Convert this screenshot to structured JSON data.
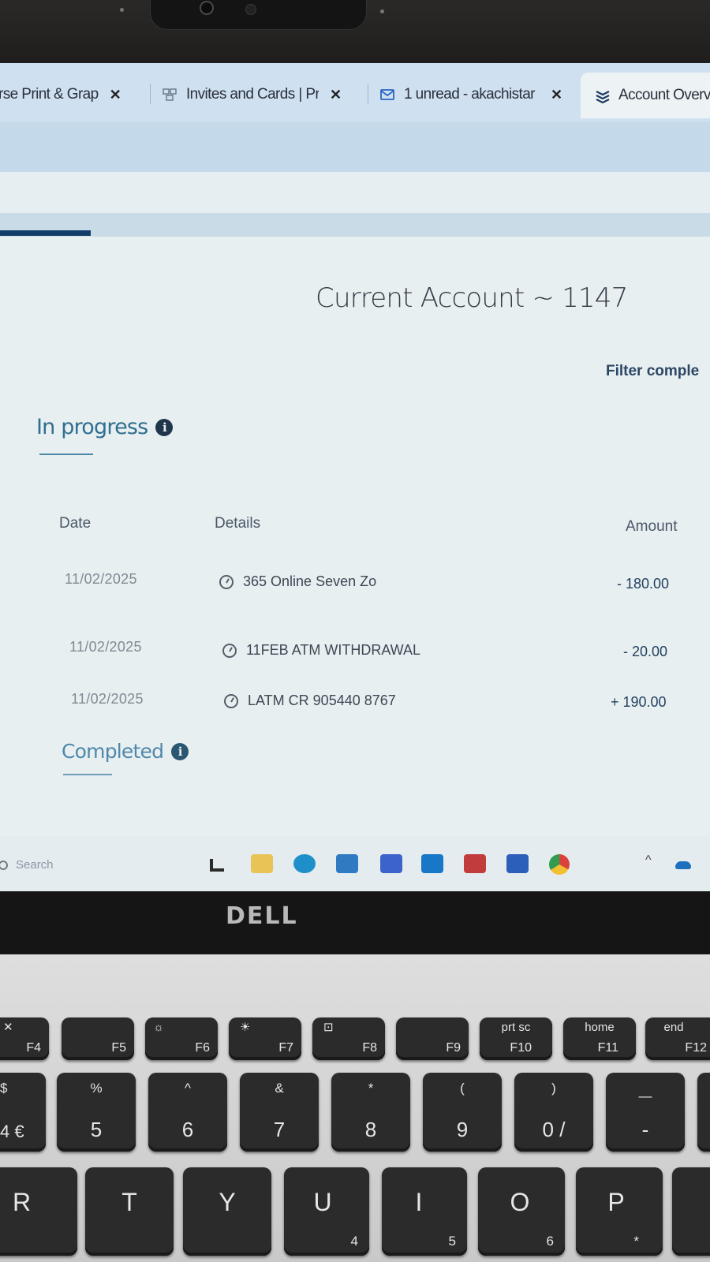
{
  "browser": {
    "tabs": [
      {
        "label": "rse Print & Grap",
        "close": "✕"
      },
      {
        "label": "Invites and Cards | Pr",
        "close": "✕"
      },
      {
        "label": "1 unread - akachistar",
        "close": "✕"
      },
      {
        "label": "Account Overv",
        "active": true
      }
    ]
  },
  "page": {
    "account_title": "Current Account ~ 1147",
    "filter_link": "Filter comple",
    "in_progress": {
      "label": "In progress",
      "info": "i"
    },
    "columns": {
      "date": "Date",
      "details": "Details",
      "amount": "Amount"
    },
    "transactions": [
      {
        "date": "11/02/2025",
        "details": "365 Online Seven Zo",
        "amount": "- 180.00"
      },
      {
        "date": "11/02/2025",
        "details": "11FEB ATM WITHDRAWAL",
        "amount": "- 20.00"
      },
      {
        "date": "11/02/2025",
        "details": "LATM CR 905440 8767",
        "amount": "+ 190.00"
      }
    ],
    "completed": {
      "label": "Completed",
      "info": "i"
    }
  },
  "taskbar": {
    "search_label": "Search",
    "apps": [
      "file-explorer-icon",
      "folder-icon",
      "edge-icon",
      "store-icon",
      "mail-icon",
      "outlook-icon",
      "acrobat-icon",
      "word-icon",
      "chrome-icon"
    ],
    "tray_chevron": "^"
  },
  "laptop": {
    "brand": "DELL"
  },
  "keyboard": {
    "frow": [
      {
        "top": "✕",
        "fn": "F4"
      },
      {
        "top": "",
        "fn": "F5"
      },
      {
        "top": "☼",
        "fn": "F6"
      },
      {
        "top": "☀",
        "fn": "F7"
      },
      {
        "top": "⊡",
        "fn": "F8"
      },
      {
        "top": "",
        "fn": "F9"
      },
      {
        "top": "prt sc",
        "fn": "F10"
      },
      {
        "top": "home",
        "fn": "F11"
      },
      {
        "top": "end",
        "fn": "F12"
      }
    ],
    "numrow": [
      {
        "sym": "$",
        "main": "4 €"
      },
      {
        "sym": "%",
        "main": "5"
      },
      {
        "sym": "^",
        "main": "6"
      },
      {
        "sym": "&",
        "main": "7"
      },
      {
        "sym": "*",
        "main": "8"
      },
      {
        "sym": "(",
        "main": "9"
      },
      {
        "sym": ")",
        "main": "0 /"
      },
      {
        "sym": "—",
        "main": "-"
      }
    ],
    "letters": [
      {
        "main": "R",
        "sub": ""
      },
      {
        "main": "T",
        "sub": ""
      },
      {
        "main": "Y",
        "sub": ""
      },
      {
        "main": "U",
        "sub": "4"
      },
      {
        "main": "I",
        "sub": "5"
      },
      {
        "main": "O",
        "sub": "6"
      },
      {
        "main": "P",
        "sub": "*"
      }
    ]
  },
  "colors": {
    "accent": "#2f6f90",
    "amount": "#1f3f5e",
    "tabbar": "#cfe1f1"
  }
}
